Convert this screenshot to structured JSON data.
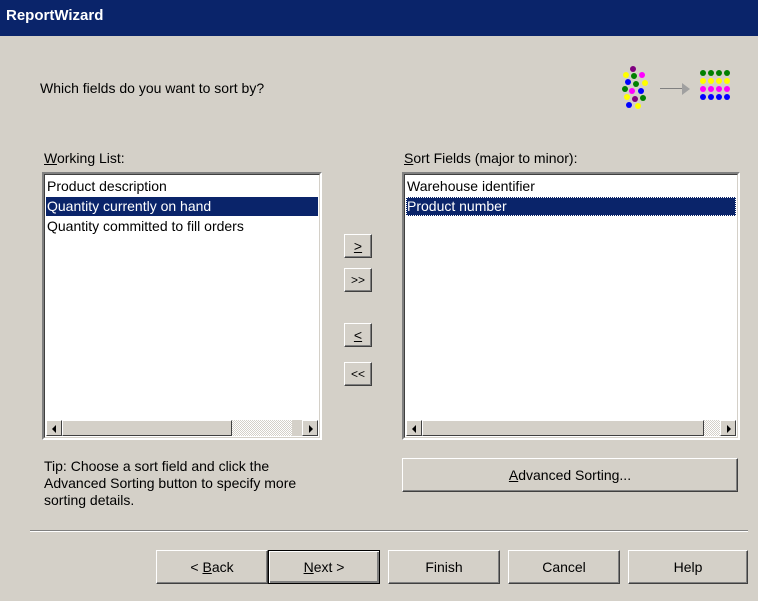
{
  "window": {
    "title": "ReportWizard"
  },
  "header": {
    "question": "Which fields do you want to sort by?"
  },
  "working_list": {
    "label_accel": "W",
    "label_rest": "orking List:",
    "items": [
      {
        "text": "Product description",
        "selected": false
      },
      {
        "text": "Quantity currently on hand",
        "selected": true
      },
      {
        "text": "Quantity committed to fill orders",
        "selected": false
      }
    ]
  },
  "sort_fields": {
    "label_accel": "S",
    "label_rest": "ort Fields (major to minor):",
    "items": [
      {
        "text": "Warehouse identifier",
        "selected": false
      },
      {
        "text": "Product number",
        "selected": true
      }
    ]
  },
  "move_buttons": {
    "add_one": ">",
    "add_all": ">>",
    "remove_one": "<",
    "remove_all": "<<"
  },
  "tip": {
    "line1": "Tip:  Choose a sort field and click the",
    "line2": "Advanced Sorting button to specify more",
    "line3": "sorting details."
  },
  "advanced_sorting": {
    "accel": "A",
    "rest": "dvanced Sorting..."
  },
  "footer": {
    "back": {
      "prefix": "< ",
      "accel": "B",
      "rest": "ack"
    },
    "next": {
      "accel": "N",
      "rest": "ext >"
    },
    "finish": "Finish",
    "cancel": "Cancel",
    "help": "Help"
  },
  "colors": {
    "dialog_bg": "#d4d0c8",
    "title_bar": "#0a246a",
    "selection": "#0a246a"
  },
  "icons": [
    "sort-graphic-icon",
    "scroll-left-arrow-icon",
    "scroll-right-arrow-icon"
  ]
}
